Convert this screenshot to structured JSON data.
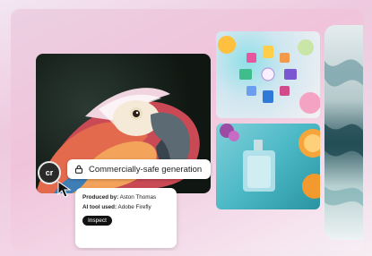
{
  "badge": {
    "text": "Commercially-safe generation"
  },
  "avatar": {
    "initials": "cr"
  },
  "info": {
    "produced_label": "Produced by:",
    "produced_value": "Aston Thomas",
    "tool_label": "AI tool used:",
    "tool_value": "Adobe Firefly",
    "inspect_label": "Inspect"
  }
}
